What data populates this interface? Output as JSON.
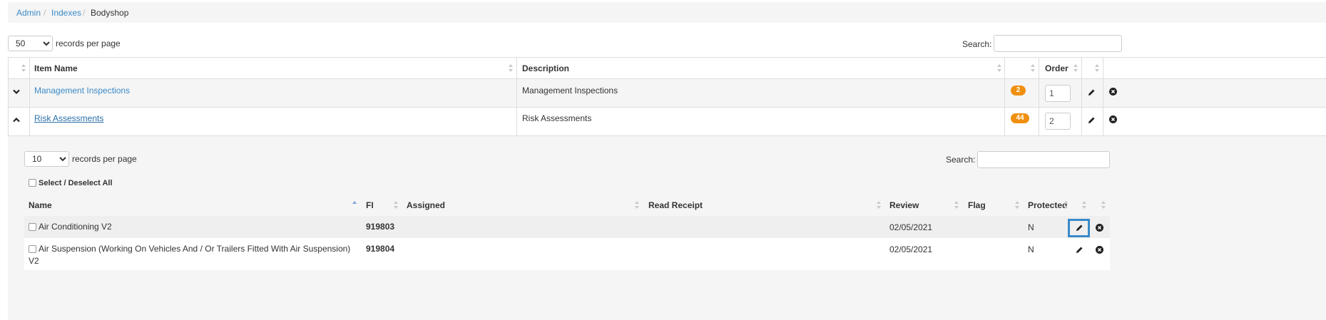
{
  "breadcrumb": {
    "items": [
      "Admin",
      "Indexes",
      "Bodyshop"
    ],
    "separator": "/"
  },
  "outer": {
    "records_per_page": "50",
    "records_per_page_label": "records per page",
    "search_label": "Search:",
    "columns": {
      "item_name": "Item Name",
      "description": "Description",
      "order": "Order"
    },
    "rows": [
      {
        "name": "Management Inspections",
        "description": "Management Inspections",
        "count": "2",
        "order": "1",
        "expanded": false
      },
      {
        "name": "Risk Assessments",
        "description": "Risk Assessments",
        "count": "44",
        "order": "2",
        "expanded": true
      }
    ]
  },
  "inner": {
    "records_per_page": "10",
    "records_per_page_label": "records per page",
    "search_label": "Search:",
    "select_all_label": "Select / Deselect All",
    "columns": {
      "name": "Name",
      "fi": "FI",
      "assigned": "Assigned",
      "read_receipt": "Read Receipt",
      "review": "Review",
      "flag": "Flag",
      "protected": "Protected"
    },
    "rows": [
      {
        "name": "Air Conditioning V2",
        "fi": "919803",
        "assigned": "",
        "read_receipt": "",
        "review": "02/05/2021",
        "flag": "",
        "protected": "N"
      },
      {
        "name_line1": "Air Suspension (Working On Vehicles And / Or Trailers Fitted With Air Suspension)",
        "name_line2": "V2",
        "fi": "919804",
        "assigned": "",
        "read_receipt": "",
        "review": "02/05/2021",
        "flag": "",
        "protected": "N"
      }
    ]
  },
  "colors": {
    "link": "#3a8ac8",
    "badge": "#f0900f",
    "focus": "#3a8ac8"
  }
}
